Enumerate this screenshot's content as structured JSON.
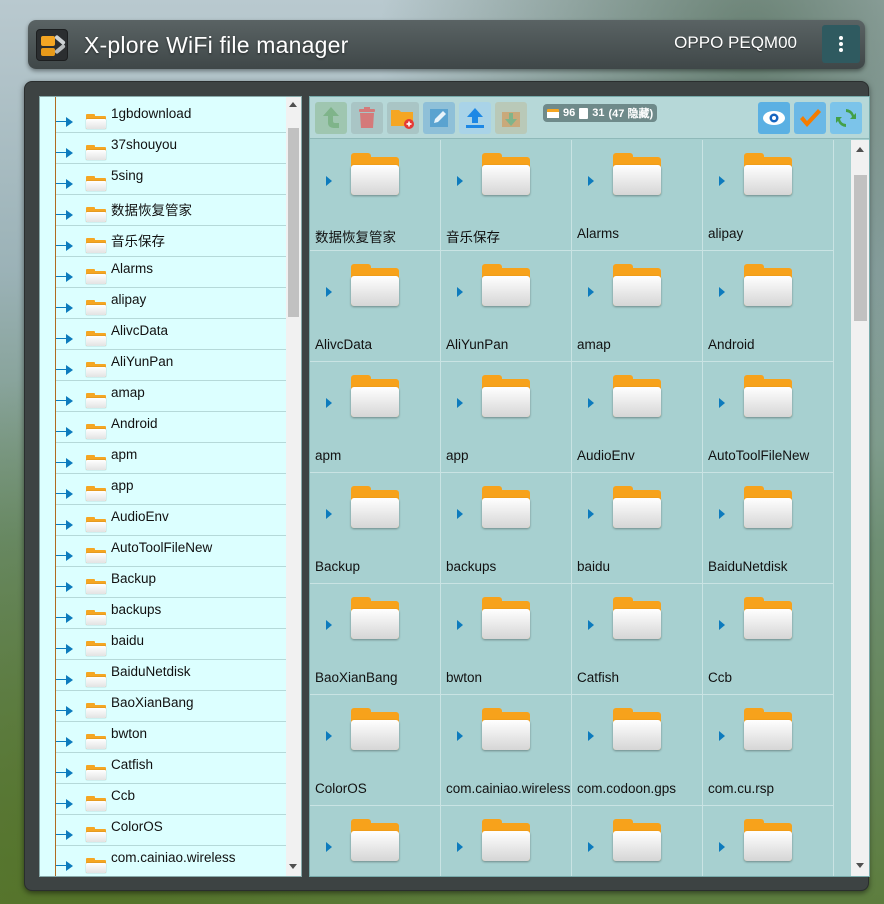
{
  "header": {
    "app_title": "X-plore WiFi file manager",
    "device_name": "OPPO PEQM00",
    "menu_icon": "kebab-menu-icon"
  },
  "colors": {
    "tree_bg": "#dcffff",
    "grid_bg": "#a7d0d0",
    "folder_orange": "#f7a21b",
    "arrow_blue": "#0d7bbd",
    "header_bg": "#4a5253"
  },
  "tree": {
    "items": [
      "1gbdownload",
      "37shouyou",
      "5sing",
      "数据恢复管家",
      "音乐保存",
      "Alarms",
      "alipay",
      "AlivcData",
      "AliYunPan",
      "amap",
      "Android",
      "apm",
      "app",
      "AudioEnv",
      "AutoToolFileNew",
      "Backup",
      "backups",
      "baidu",
      "BaiduNetdisk",
      "BaoXianBang",
      "bwton",
      "Catfish",
      "Ccb",
      "ColorOS",
      "com.cainiao.wireless"
    ]
  },
  "toolbar": {
    "up_icon": "up-arrow-icon",
    "delete_icon": "trash-icon",
    "new_folder_icon": "new-folder-icon",
    "rename_icon": "edit-icon",
    "upload_icon": "upload-icon",
    "download_icon": "download-icon",
    "folder_count": "96",
    "file_count": "31",
    "hidden_count": "(47 隐藏)",
    "view_icon": "eye-icon",
    "select_icon": "checkmark-icon",
    "refresh_icon": "refresh-icon"
  },
  "grid": {
    "items": [
      "数据恢复管家",
      "音乐保存",
      "Alarms",
      "alipay",
      "AlivcData",
      "AliYunPan",
      "amap",
      "Android",
      "apm",
      "app",
      "AudioEnv",
      "AutoToolFileNew",
      "Backup",
      "backups",
      "baidu",
      "BaiduNetdisk",
      "BaoXianBang",
      "bwton",
      "Catfish",
      "Ccb",
      "ColorOS",
      "com.cainiao.wireless",
      "com.codoon.gps",
      "com.cu.rsp",
      "",
      "",
      "",
      ""
    ]
  }
}
